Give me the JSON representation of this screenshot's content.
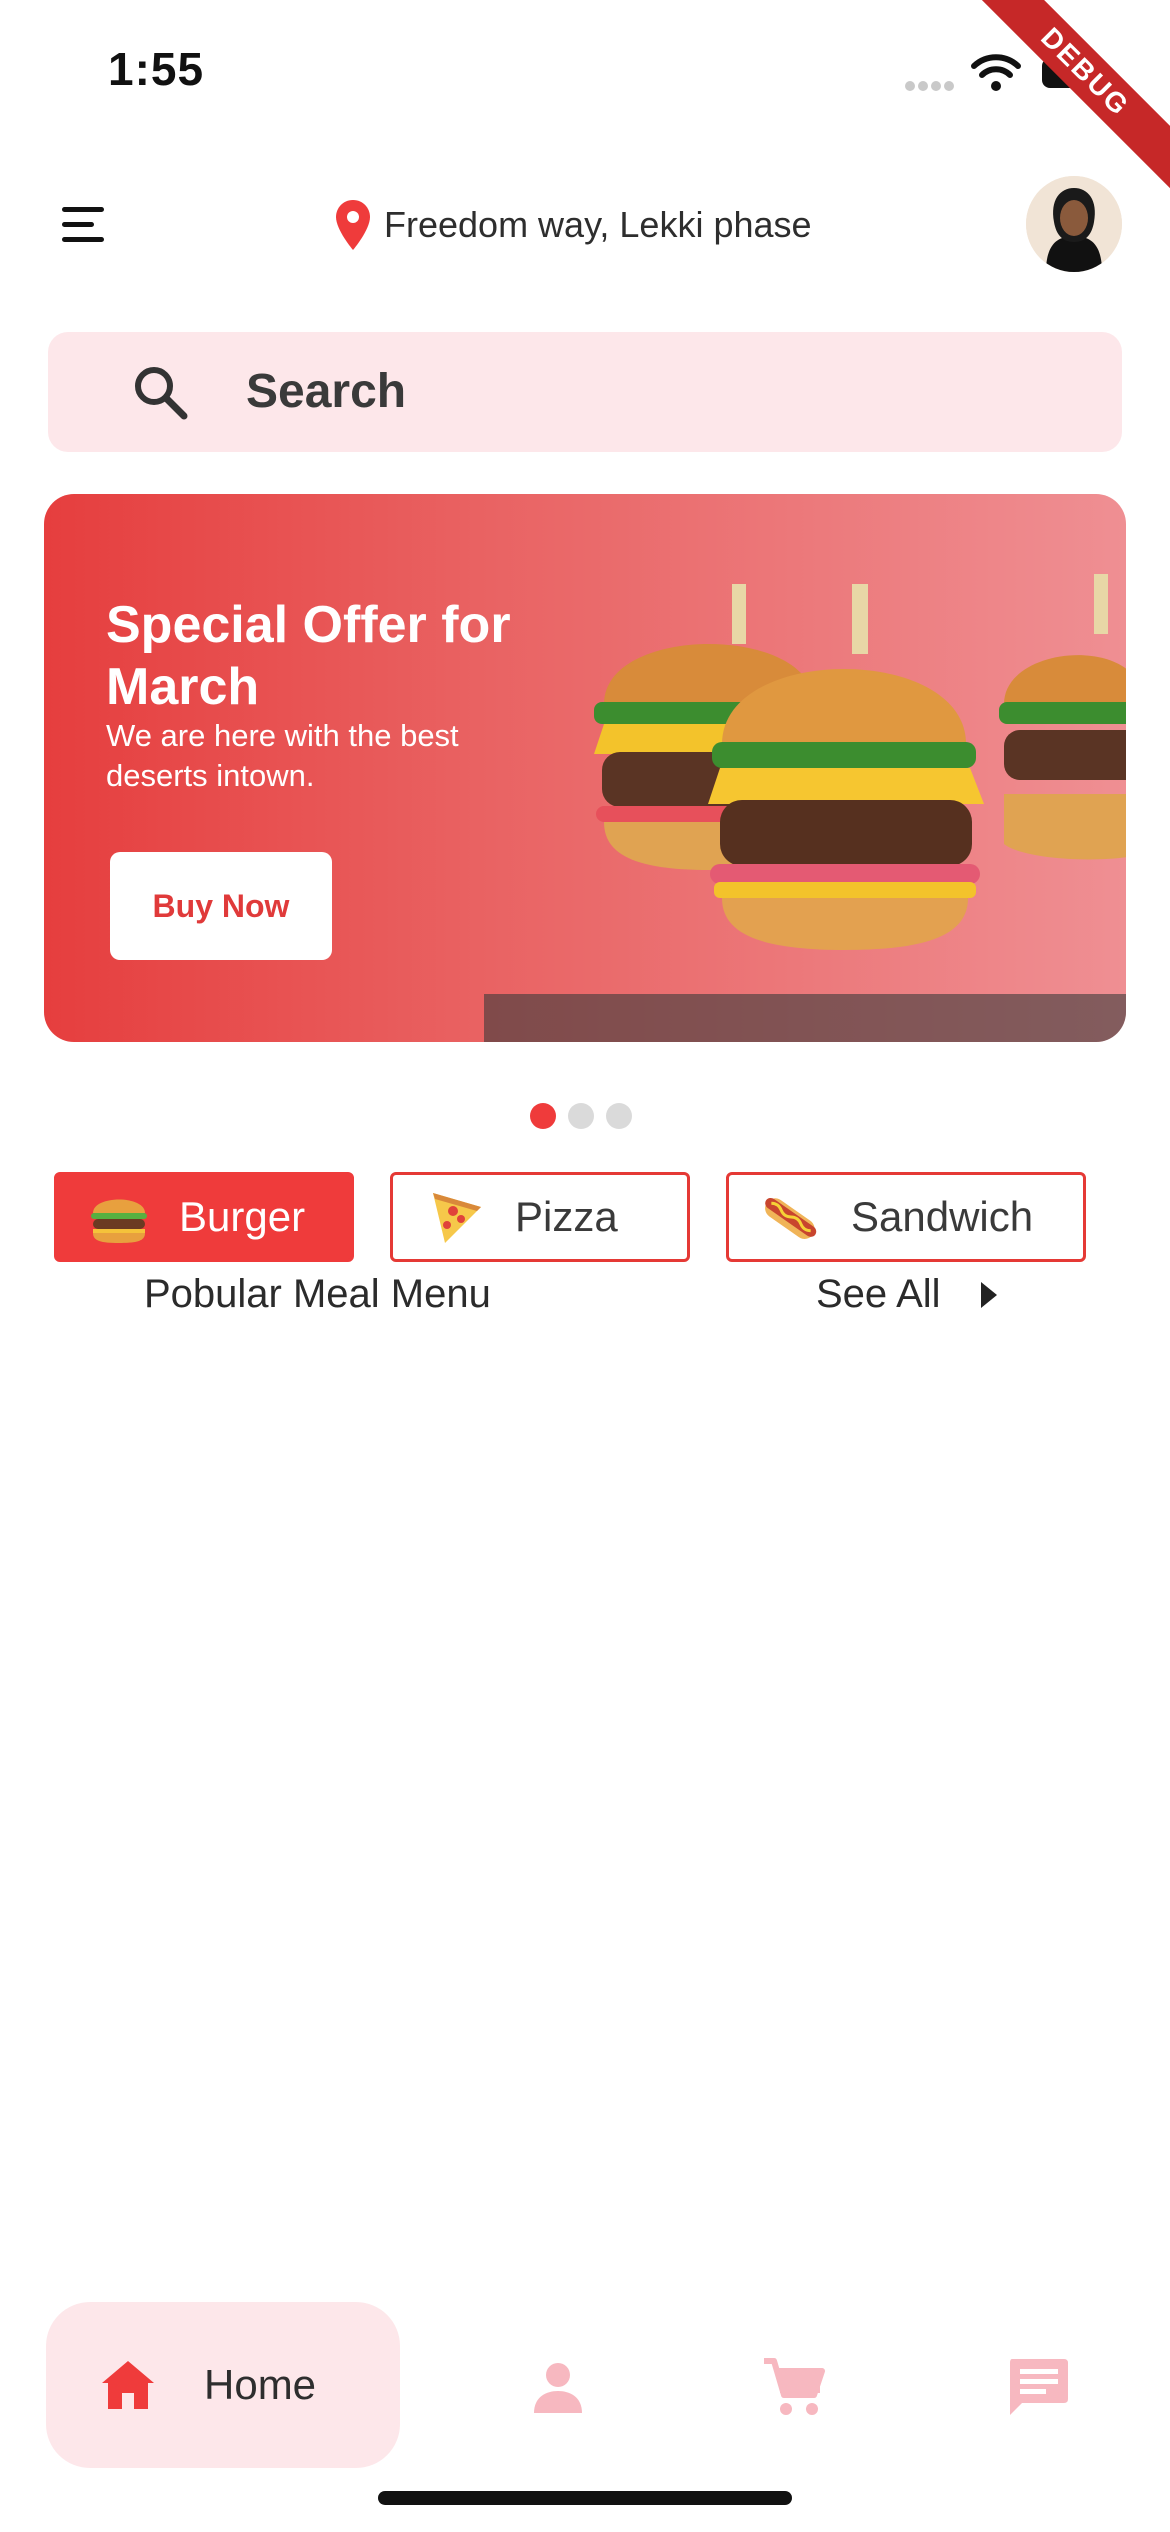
{
  "status_bar": {
    "time": "1:55",
    "debug_label": "DEBUG"
  },
  "header": {
    "menu_icon": "menu-icon",
    "location_icon": "location-pin-icon",
    "location_text": "Freedom way, Lekki phase",
    "avatar": "user-avatar"
  },
  "search": {
    "placeholder": "Search",
    "icon": "search-icon"
  },
  "banner": {
    "title": "Special Offer for March",
    "subtitle": "We are here with the best deserts intown.",
    "button_label": "Buy Now",
    "image": "burgers-image",
    "page_count": 3,
    "active_page": 1
  },
  "categories": [
    {
      "label": "Burger",
      "icon": "burger-icon",
      "selected": true
    },
    {
      "label": "Pizza",
      "icon": "pizza-icon",
      "selected": false
    },
    {
      "label": "Sandwich",
      "icon": "hotdog-icon",
      "selected": false
    }
  ],
  "section": {
    "title": "Pobular Meal Menu",
    "see_all": "See All"
  },
  "bottom_nav": [
    {
      "label": "Home",
      "icon": "home-icon",
      "active": true
    },
    {
      "label": "",
      "icon": "person-icon",
      "active": false
    },
    {
      "label": "",
      "icon": "cart-icon",
      "active": false
    },
    {
      "label": "",
      "icon": "chat-icon",
      "active": false
    }
  ],
  "colors": {
    "accent": "#EF3B3B",
    "search_bg": "#FDE7EA",
    "nav_inactive": "#F7B8C0"
  }
}
